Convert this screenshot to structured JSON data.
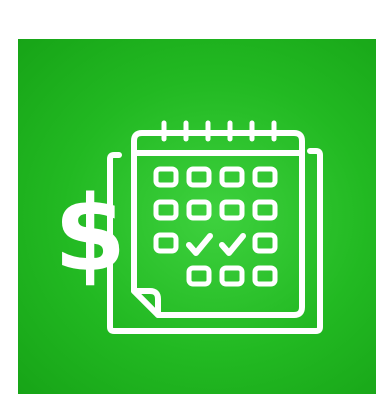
{
  "icon": {
    "name": "calendar-payment-icon",
    "background_color": "#22b922",
    "foreground_color": "#ffffff",
    "symbol": "$",
    "calendar_grid": {
      "rows": 4,
      "cols": 4,
      "checked_cells": [
        [
          2,
          1
        ],
        [
          2,
          2
        ]
      ],
      "empty_cells": [
        [
          3,
          0
        ]
      ]
    }
  }
}
